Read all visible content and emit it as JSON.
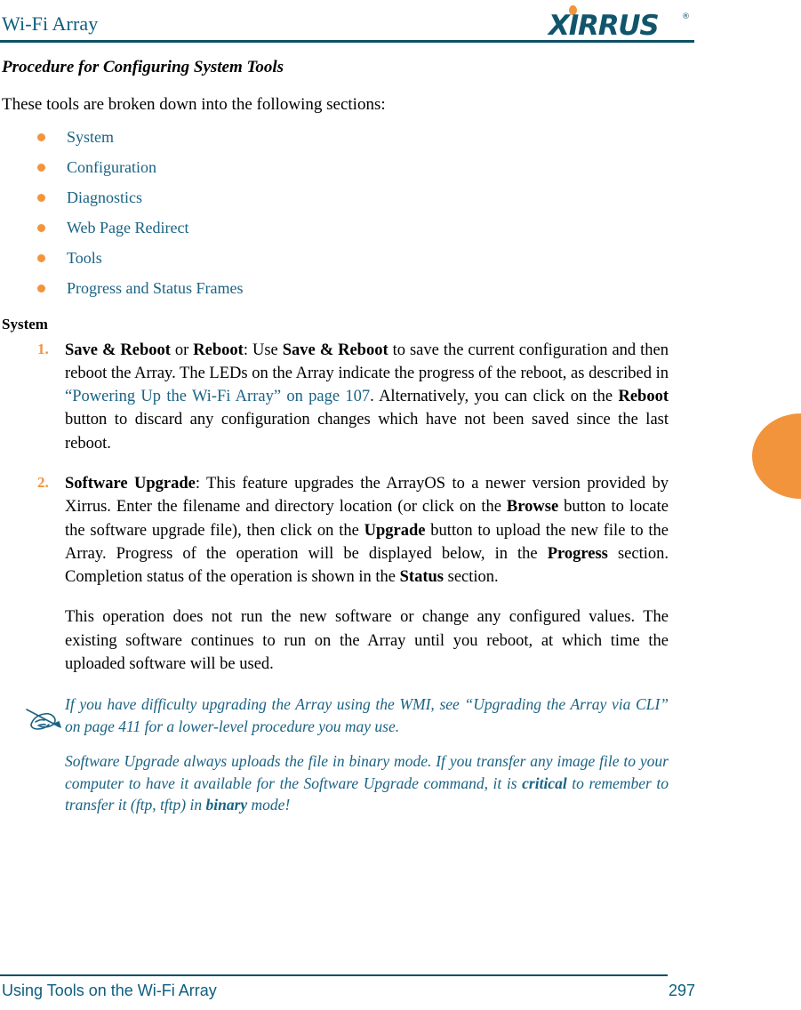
{
  "header": {
    "title": "Wi-Fi Array",
    "logo_text": "XIRRUS",
    "logo_trademark": "®",
    "accent_orange": "#f2943c",
    "accent_teal": "#0d5e7e"
  },
  "main": {
    "section_heading": "Procedure for Configuring System Tools",
    "intro_paragraph": "These tools are broken down into the following sections:",
    "bullets": [
      {
        "label": "System"
      },
      {
        "label": "Configuration"
      },
      {
        "label": "Diagnostics"
      },
      {
        "label": "Web Page Redirect"
      },
      {
        "label": "Tools"
      },
      {
        "label": "Progress and Status Frames"
      }
    ],
    "sub_heading": "System",
    "steps": [
      {
        "number": "1.",
        "parts": [
          {
            "text": "Save & Reboot",
            "style": "bold"
          },
          {
            "text": " or ",
            "style": "normal"
          },
          {
            "text": "Reboot",
            "style": "bold"
          },
          {
            "text": ": Use ",
            "style": "normal"
          },
          {
            "text": "Save & Reboot",
            "style": "bold"
          },
          {
            "text": " to save the current configuration and then reboot the Array. The LEDs on the Array indicate the progress of the reboot, as described in ",
            "style": "normal"
          },
          {
            "text": "“Powering Up the Wi-Fi Array” on page 107",
            "style": "link"
          },
          {
            "text": ". Alternatively, you can click on the ",
            "style": "normal"
          },
          {
            "text": "Reboot",
            "style": "bold"
          },
          {
            "text": " button to discard any configuration changes which have not been saved since the last reboot.",
            "style": "normal"
          }
        ]
      },
      {
        "number": "2.",
        "parts": [
          {
            "text": "Software Upgrade",
            "style": "bold"
          },
          {
            "text": ": This feature upgrades the ArrayOS to a newer version provided by Xirrus. Enter the filename and directory location (or click on the ",
            "style": "normal"
          },
          {
            "text": "Browse",
            "style": "bold"
          },
          {
            "text": " button to locate the software upgrade file), then click on the ",
            "style": "normal"
          },
          {
            "text": "Upgrade",
            "style": "bold"
          },
          {
            "text": " button to upload the new file to the Array. Progress of the operation will be displayed below, in the ",
            "style": "normal"
          },
          {
            "text": "Progress",
            "style": "bold"
          },
          {
            "text": " section. Completion status of the operation is shown in the ",
            "style": "normal"
          },
          {
            "text": "Status",
            "style": "bold"
          },
          {
            "text": " section.",
            "style": "normal"
          }
        ]
      }
    ],
    "follow_up_paragraph": "This operation does not run the new software or change any configured values. The existing software continues to run on the Array until you reboot, at which time the uploaded software will be used.",
    "note": {
      "icon": "note-pen-icon",
      "paragraphs": [
        {
          "parts": [
            {
              "text": "If you have difficulty upgrading the Array using the WMI, see “Upgrading the Array via CLI” on page 411 for a lower-level procedure you may use.",
              "style": "normal"
            }
          ]
        },
        {
          "parts": [
            {
              "text": "Software Upgrade always uploads the file in binary mode. If you transfer any image file to your computer to have it available for the Software Upgrade command, it is ",
              "style": "normal"
            },
            {
              "text": "critical",
              "style": "bold"
            },
            {
              "text": " to remember to transfer it (ftp, tftp) in ",
              "style": "normal"
            },
            {
              "text": "binary",
              "style": "bold"
            },
            {
              "text": " mode!",
              "style": "normal"
            }
          ]
        }
      ]
    },
    "side_tab_color": "#f2943c"
  },
  "footer": {
    "left_text": "Using Tools on the Wi-Fi Array",
    "page_number": "297"
  }
}
